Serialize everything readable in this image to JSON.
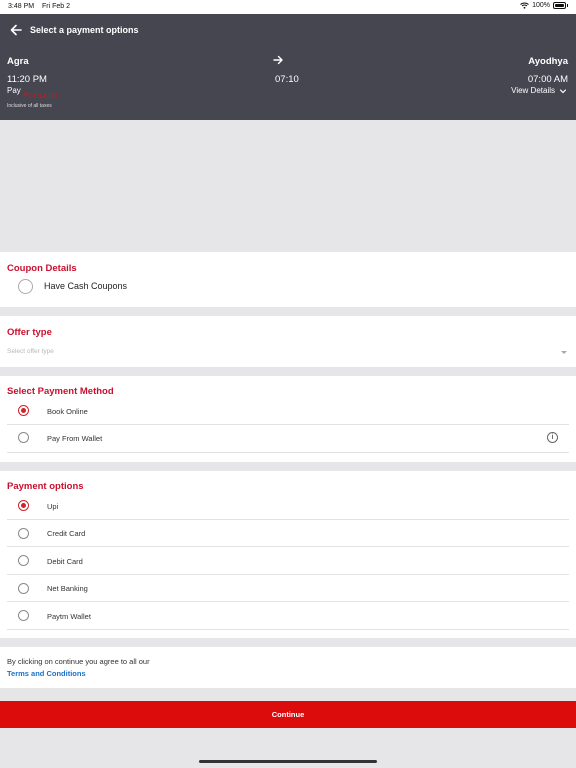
{
  "status_bar": {
    "time": "3:48 PM",
    "date": "Fri Feb 2",
    "battery": "100%"
  },
  "header": {
    "title": "Select a payment options",
    "from_city": "Agra",
    "to_city": "Ayodhya",
    "departure_time": "11:20 PM",
    "duration": "07:10",
    "arrival_time": "07:00 AM",
    "pay_label": "Pay",
    "pay_amount": "₹1,014.00",
    "taxes_note": "Inclusive of all taxes",
    "view_details": "View  Details"
  },
  "coupon": {
    "title": "Coupon Details",
    "option_label": "Have Cash Coupons"
  },
  "offer": {
    "title": "Offer type",
    "placeholder": "Select offer type"
  },
  "payment_method": {
    "title": "Select Payment Method",
    "options": [
      {
        "label": "Book Online",
        "selected": true
      },
      {
        "label": "Pay From Wallet",
        "selected": false
      }
    ]
  },
  "payment_options": {
    "title": "Payment options",
    "options": [
      {
        "label": "Upi",
        "selected": true
      },
      {
        "label": "Credit Card",
        "selected": false
      },
      {
        "label": "Debit Card",
        "selected": false
      },
      {
        "label": "Net Banking",
        "selected": false
      },
      {
        "label": "Paytm Wallet",
        "selected": false
      }
    ]
  },
  "terms": {
    "text": "By clicking on continue you agree to all our",
    "link": "Terms and Conditions"
  },
  "continue_label": "Continue",
  "colors": {
    "header_bg": "#464651",
    "accent_red": "#c8102e",
    "button_red": "#dd0c0c",
    "link_blue": "#1a73c8"
  },
  "icons": {
    "back": "back-arrow-icon",
    "route": "right-arrow-icon",
    "details": "chevron-down-icon",
    "info": "info-icon",
    "wifi": "wifi-icon",
    "battery": "battery-icon"
  }
}
